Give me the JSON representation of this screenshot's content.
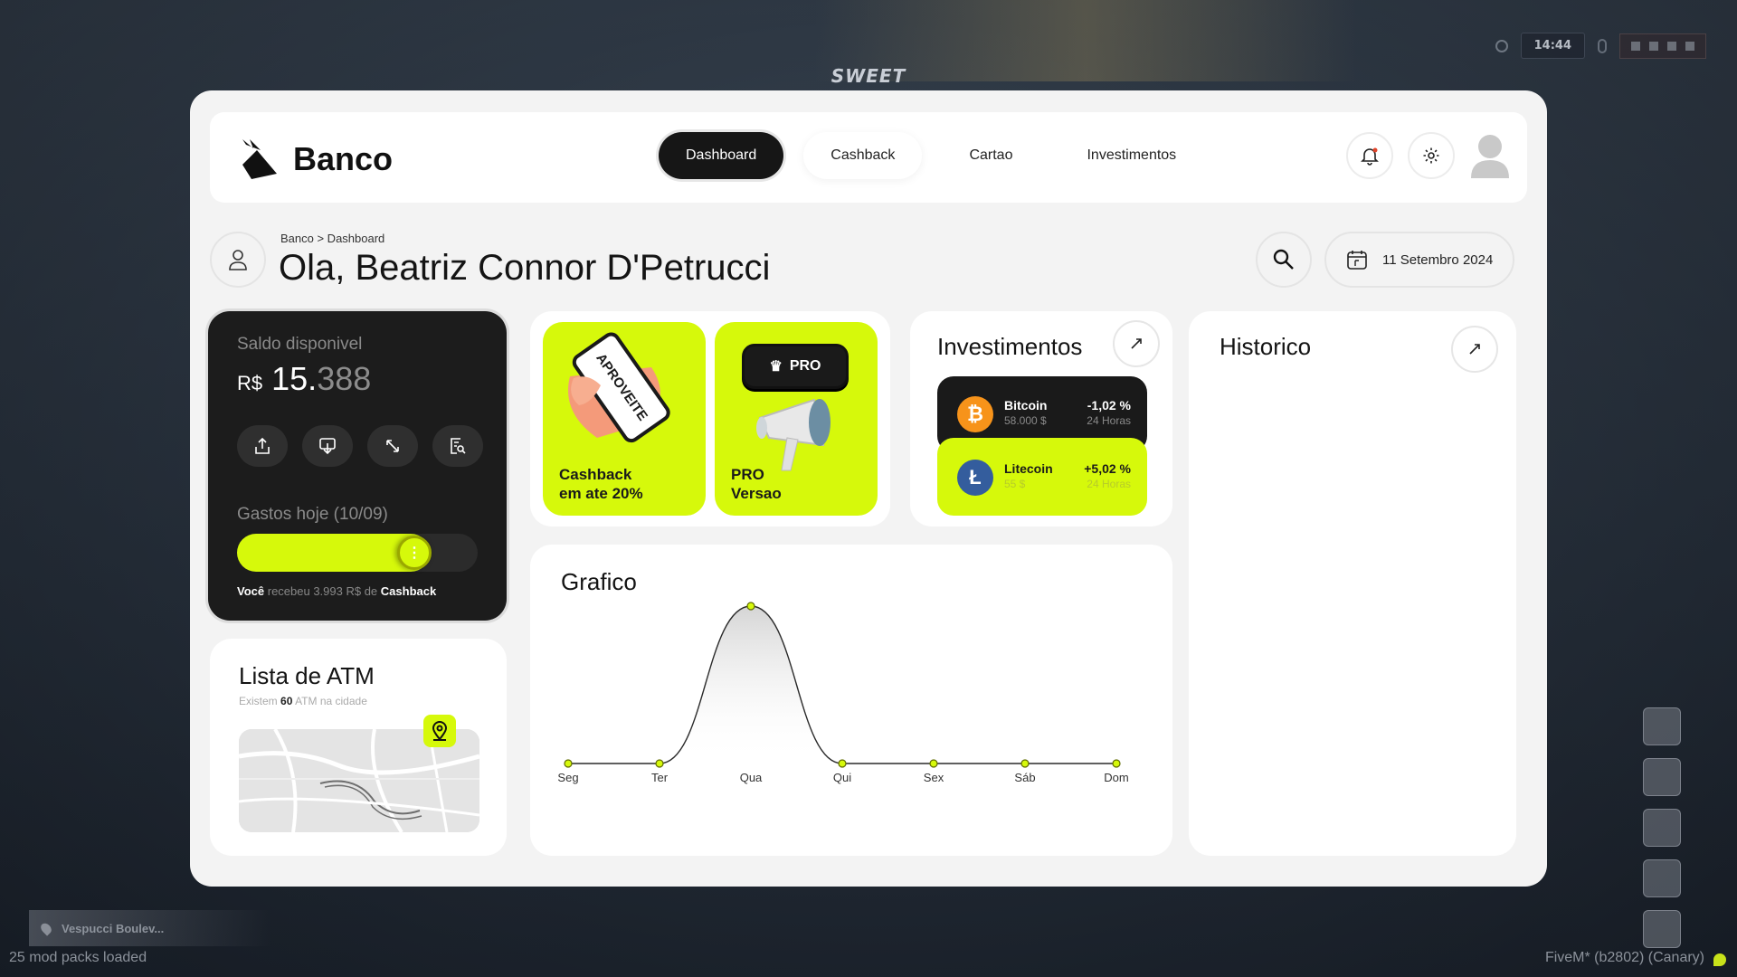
{
  "hud": {
    "time": "14:44",
    "logo": "SWEET",
    "location": "Vespucci Boulev...",
    "mods": "25 mod packs loaded",
    "build": "FiveM* (b2802) (Canary)"
  },
  "brand": {
    "name": "Banco"
  },
  "nav": [
    {
      "label": "Dashboard",
      "active": true
    },
    {
      "label": "Cashback",
      "active": false
    },
    {
      "label": "Cartao",
      "active": false
    },
    {
      "label": "Investimentos",
      "active": false
    }
  ],
  "header": {
    "breadcrumb": "Banco > Dashboard",
    "greeting": "Ola, Beatriz Connor D'Petrucci",
    "date": "11 Setembro 2024"
  },
  "balance": {
    "label": "Saldo disponivel",
    "currency": "R$",
    "value_main": "15.",
    "value_dim": "388",
    "spend_label": "Gastos hoje (10/09)",
    "spend_progress": 0.8,
    "note_you": "Você",
    "note_mid": "recebeu 3.993 R$ de",
    "note_cashback": "Cashback"
  },
  "atm": {
    "title": "Lista de ATM",
    "sub_prefix": "Existem",
    "count": "60",
    "sub_suffix": "ATM na cidade"
  },
  "promos": {
    "cashback_line1": "Cashback",
    "cashback_line2": "em ate 20%",
    "phone_text": "APROVEITE",
    "pro_badge": "PRO",
    "pro_line1": "PRO",
    "pro_line2": "Versao"
  },
  "investimentos": {
    "title": "Investimentos",
    "coins": [
      {
        "name": "Bitcoin",
        "value": "58.000 $",
        "change": "-1,02 %",
        "period": "24 Horas"
      },
      {
        "name": "Litecoin",
        "value": "55 $",
        "change": "+5,02 %",
        "period": "24 Horas"
      }
    ]
  },
  "historico": {
    "title": "Historico"
  },
  "grafico": {
    "title": "Grafico"
  },
  "chart_data": {
    "type": "line",
    "title": "Grafico",
    "categories": [
      "Seg",
      "Ter",
      "Qua",
      "Qui",
      "Sex",
      "Sáb",
      "Dom"
    ],
    "values": [
      0,
      0,
      1,
      0,
      0,
      0,
      0
    ],
    "ylim": [
      0,
      1
    ],
    "grid": false,
    "colors": {
      "line": "#2a2a2a",
      "point": "#d6f90b"
    }
  },
  "colors": {
    "accent": "#d6f90b",
    "dark": "#1c1c1c",
    "bitcoin": "#f7931a",
    "litecoin": "#345d9d"
  }
}
